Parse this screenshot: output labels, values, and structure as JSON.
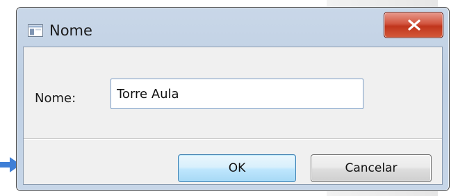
{
  "window": {
    "title": "Nome",
    "app_icon": "window-app-icon",
    "close_icon": "close-icon"
  },
  "form": {
    "label": "Nome:",
    "input_value": "Torre Aula"
  },
  "buttons": {
    "ok_label": "OK",
    "cancel_label": "Cancelar"
  },
  "colors": {
    "close_button": "#c8452a",
    "ok_button_border": "#3c7fb1",
    "pointer_arrow": "#3f7fd6"
  },
  "annotation": {
    "pointer": "arrow-icon"
  }
}
